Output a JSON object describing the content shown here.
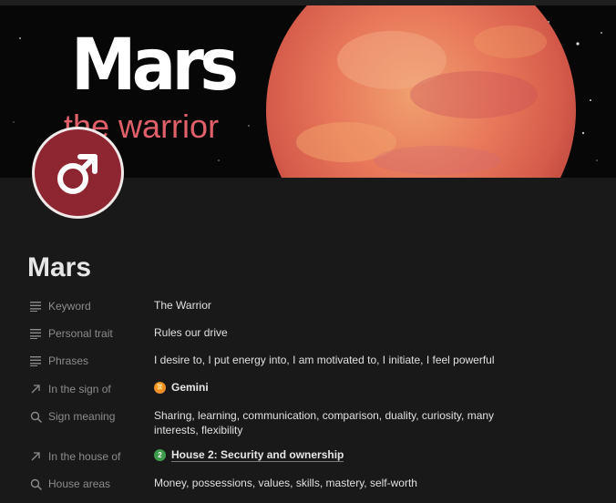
{
  "cover": {
    "title": "Mars",
    "subtitle": "the warrior"
  },
  "page": {
    "icon": "mars-symbol-icon",
    "title": "Mars"
  },
  "properties": [
    {
      "icon": "text-lines-icon",
      "name": "Keyword",
      "value": "The Warrior"
    },
    {
      "icon": "text-lines-icon",
      "name": "Personal trait",
      "value": "Rules our drive"
    },
    {
      "icon": "text-lines-icon",
      "name": "Phrases",
      "value": "I desire to, I put energy into, I am motivated to, I initiate, I feel powerful"
    },
    {
      "icon": "relation-arrow-icon",
      "name": "In the sign of",
      "value": "Gemini",
      "emoji": "♊"
    },
    {
      "icon": "search-icon",
      "name": "Sign meaning",
      "value": "Sharing, learning, communication, comparison, duality, curiosity, many interests, flexibility"
    },
    {
      "icon": "relation-arrow-icon",
      "name": "In the house of",
      "value": "House 2: Security and ownership",
      "emoji": "2"
    },
    {
      "icon": "search-icon",
      "name": "House areas",
      "value": "Money, possessions, values, skills, mastery, self-worth"
    }
  ],
  "colors": {
    "background": "#191919",
    "badge": "#8e2631",
    "subtitle": "#e0606a"
  }
}
